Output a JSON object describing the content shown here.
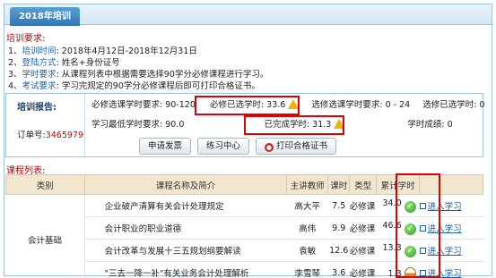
{
  "header": {
    "tab_title": "2018年培训"
  },
  "requirements": {
    "title": "培训要求:",
    "items": [
      {
        "prefix": "1、",
        "key": "培训时间",
        "value": ": 2018年4月12日-2018年12月31日"
      },
      {
        "prefix": "2、",
        "key": "登陆方式",
        "value": ": 姓名+身份证号"
      },
      {
        "prefix": "3、",
        "key": "学时要求",
        "value": ": 从课程列表中根据需要选择90学分必修课程进行学习。"
      },
      {
        "prefix": "4、",
        "key": "考试要求",
        "value": ": 学习完规定的90学分必修课程后即可打印合格证书。"
      }
    ]
  },
  "report": {
    "title": "培训报告:",
    "order_label": "订单号:",
    "order_number": "3465979",
    "required_label": "必修选课学时要求: 90-120",
    "required_selected_label": "必修已选学时:",
    "required_selected_value": "33.6",
    "elective_req_label": "选修选课学时要求: 0 - 24",
    "elective_selected_label": "选修已选学时: 0",
    "min_hours_label": "学习最低学时要求: 90.0",
    "completed_label": "已完成学时:",
    "completed_value": "31.3",
    "score_label": "学时成绩: 0"
  },
  "buttons": {
    "invoice": "申请发票",
    "practice": "练习中心",
    "print": "打印合格证书"
  },
  "courses": {
    "title": "课程列表:",
    "headers": {
      "category": "类别",
      "name": "课程名称及简介",
      "teacher": "主讲教师",
      "hours": "课时",
      "type": "类型",
      "cumulative": "累计学时"
    },
    "category": "会计基础",
    "rows": [
      {
        "name": "企业破产清算有关会计处理规定",
        "teacher": "高大平",
        "hours": "7.5",
        "type": "必修课",
        "cumulative": "34.0",
        "status": "complete",
        "action": "进入学习"
      },
      {
        "name": "会计职业的职业道德",
        "teacher": "高伟",
        "hours": "9.9",
        "type": "必修课",
        "cumulative": "46.6",
        "status": "complete",
        "action": "进入学习"
      },
      {
        "name": "会计改革与发展十三五规划纲要解读",
        "teacher": "袁敏",
        "hours": "12.6",
        "type": "必修课",
        "cumulative": "13.3",
        "status": "complete",
        "action": "进入学习"
      },
      {
        "name": "\"三去一降一补\"有关业务会计处理解析",
        "teacher": "李雪琴",
        "hours": "3.6",
        "type": "必修课",
        "cumulative": "1.3",
        "status": "partial",
        "action": "进入学习"
      }
    ]
  }
}
